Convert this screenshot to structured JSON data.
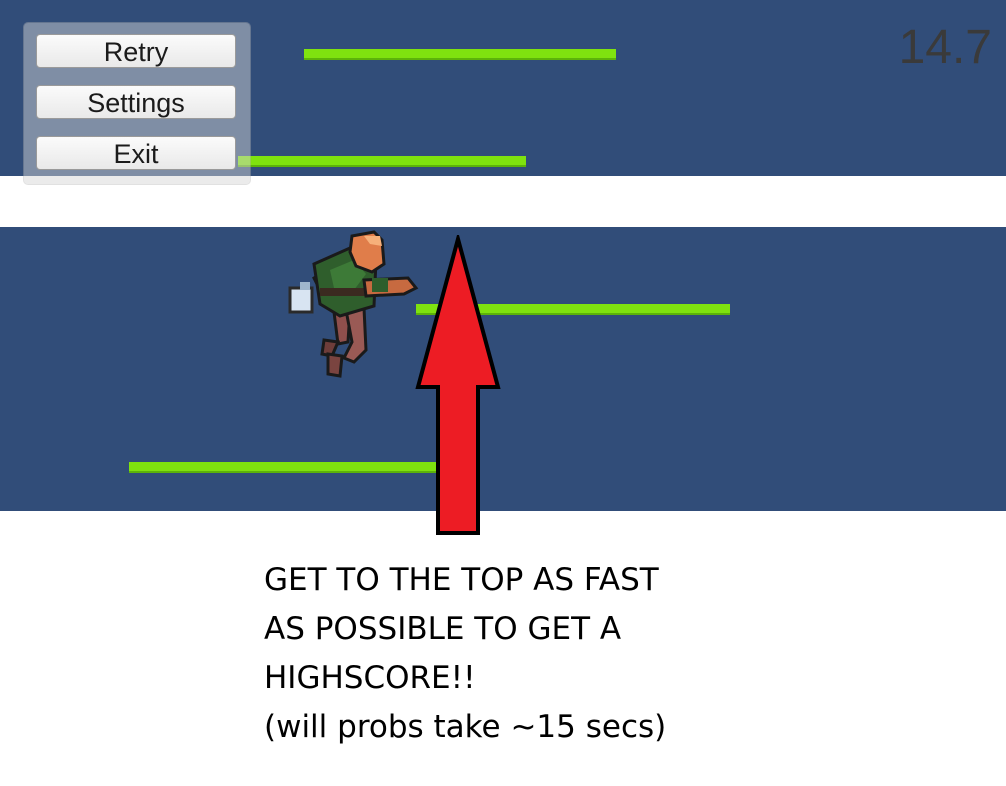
{
  "menu": {
    "retry_label": "Retry",
    "settings_label": "Settings",
    "exit_label": "Exit"
  },
  "hud": {
    "timer": "14.7"
  },
  "instructions": {
    "lines": [
      "GET TO THE TOP AS FAST",
      "AS POSSIBLE TO GET A",
      "HIGHSCORE!!",
      "(will probs take ~15 secs)"
    ]
  },
  "colors": {
    "background_band": "#314d79",
    "platform": "#7fe20f",
    "arrow_fill": "#ed1c24",
    "arrow_outline": "#000000"
  }
}
